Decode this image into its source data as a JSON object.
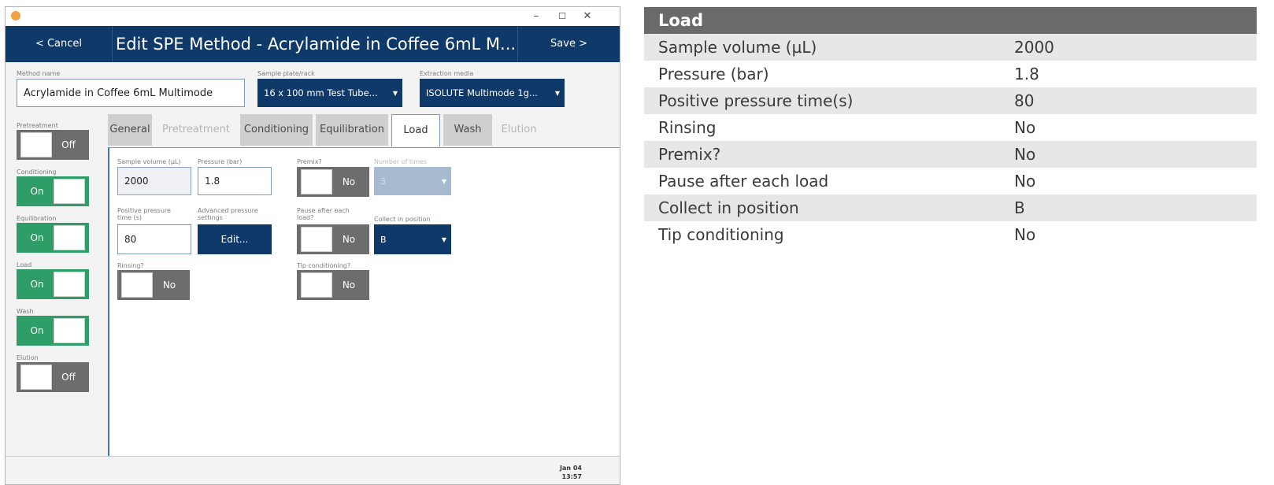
{
  "window": {
    "title": "Edit SPE Method - Acrylamide in Coffee 6mL M...",
    "cancel_label": "< Cancel",
    "save_label": "Save >",
    "minimize": "–",
    "maximize": "☐",
    "close": "✕"
  },
  "form": {
    "method_name_label": "Method name",
    "method_name_value": "Acrylamide in Coffee 6mL Multimode",
    "sample_plate_label": "Sample plate/rack",
    "sample_plate_value": "16 x 100 mm Test Tube...",
    "extraction_media_label": "Extraction media",
    "extraction_media_value": "ISOLUTE Multimode 1g..."
  },
  "steps": [
    {
      "label": "Pretreatment",
      "state": "Off"
    },
    {
      "label": "Conditioning",
      "state": "On"
    },
    {
      "label": "Equilibration",
      "state": "On"
    },
    {
      "label": "Load",
      "state": "On"
    },
    {
      "label": "Wash",
      "state": "On"
    },
    {
      "label": "Elution",
      "state": "Off"
    }
  ],
  "tabs": [
    {
      "label": "General"
    },
    {
      "label": "Pretreatment"
    },
    {
      "label": "Conditioning"
    },
    {
      "label": "Equilibration"
    },
    {
      "label": "Load"
    },
    {
      "label": "Wash"
    },
    {
      "label": "Elution"
    }
  ],
  "load_panel": {
    "sample_volume_label": "Sample volume (µL)",
    "sample_volume_value": "2000",
    "pressure_label": "Pressure (bar)",
    "pressure_value": "1.8",
    "premix_label": "Premix?",
    "premix_value": "No",
    "number_of_times_label": "Number of times",
    "number_of_times_value": "3",
    "positive_pressure_label_1": "Positive pressure",
    "positive_pressure_label_2": "time (s)",
    "positive_pressure_value": "80",
    "advanced_label_1": "Advanced pressure",
    "advanced_label_2": "settings",
    "edit_button": "Edit...",
    "pause_label_1": "Pause after each",
    "pause_label_2": "load?",
    "pause_value": "No",
    "collect_label": "Collect in position",
    "collect_value": "B",
    "rinsing_label": "Rinsing?",
    "rinsing_value": "No",
    "tip_label": "Tip conditioning?",
    "tip_value": "No"
  },
  "status": {
    "date": "Jan 04",
    "time": "13:57"
  },
  "summary": {
    "title": "Load",
    "rows": [
      {
        "key": "Sample volume (µL)",
        "value": "2000"
      },
      {
        "key": "Pressure (bar)",
        "value": "1.8"
      },
      {
        "key": "Positive pressure time(s)",
        "value": "80"
      },
      {
        "key": "Rinsing",
        "value": "No"
      },
      {
        "key": "Premix?",
        "value": "No"
      },
      {
        "key": "Pause after each load",
        "value": "No"
      },
      {
        "key": "Collect in position",
        "value": "B"
      },
      {
        "key": "Tip conditioning",
        "value": "No"
      }
    ]
  },
  "colors": {
    "navy": "#0f3968",
    "toggle_on": "#2f9d67",
    "toggle_off": "#6d6d6d",
    "table_header": "#6a6a6a",
    "row_shade": "#e7e7e7"
  }
}
